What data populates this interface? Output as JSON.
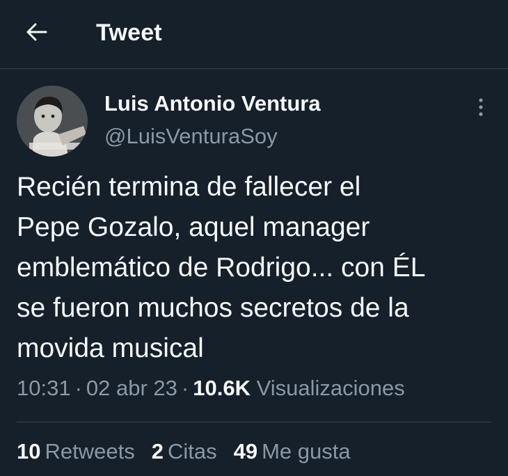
{
  "header": {
    "title": "Tweet",
    "back_icon": "arrow-left-icon"
  },
  "author": {
    "name": "Luis Antonio Ventura",
    "handle": "@LuisVenturaSoy",
    "more_icon": "vertical-dots-icon"
  },
  "tweet": {
    "text": "Recién termina de fallecer el\nPepe Gozalo, aquel manager\nemblemático de Rodrigo... con ÉL\nse fueron muchos secretos de la\nmovida musical"
  },
  "meta": {
    "time": "10:31",
    "separator": "·",
    "date": "02 abr 23",
    "views_count": "10.6K",
    "views_label": "Visualizaciones"
  },
  "stats": {
    "retweets_count": "10",
    "retweets_label": "Retweets",
    "quotes_count": "2",
    "quotes_label": "Citas",
    "likes_count": "49",
    "likes_label": "Me gusta"
  },
  "colors": {
    "background": "#15202b",
    "text_primary": "#f7f9f9",
    "text_secondary": "#8b98a5",
    "divider": "#38444d"
  }
}
